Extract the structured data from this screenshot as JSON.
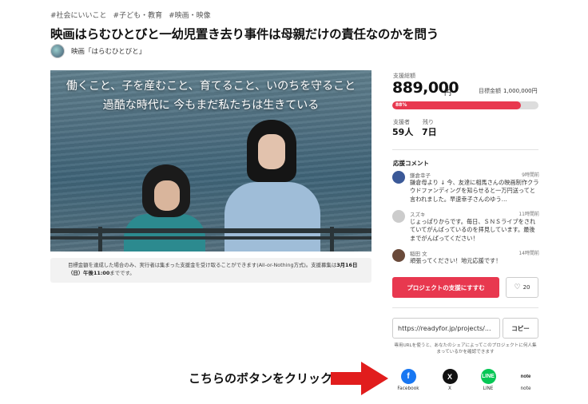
{
  "tags": [
    "#社会にいいこと",
    "#子ども・教育",
    "#映画・映像"
  ],
  "title": "映画はらむひとびと一幼児置き去り事件は母親だけの責任なのかを問う",
  "owner": {
    "name": "映画「はらむひとびと」"
  },
  "hero": {
    "line1": "働くこと、子を産むこと、育てること、いのちを守ること",
    "line2": "過酷な時代に 今もまだ私たちは生きている"
  },
  "notice": {
    "text": "目標金額を達成した場合のみ、実行者は集まった支援金を受け取ることができます(All-or-Nothing方式)。支援募集は",
    "deadline": "3月16日（日）午後11:00",
    "suffix": "までです。"
  },
  "stats": {
    "raised_label": "支援総額",
    "raised": "889,000",
    "unit": "円",
    "goal_label": "目標金額",
    "goal": "1,000,000円",
    "progress_label": "88%",
    "progress": 0.88,
    "supporters_label": "支援者",
    "supporters": "59人",
    "remaining_label": "残り",
    "remaining": "7日"
  },
  "comments": {
    "title": "応援コメント",
    "items": [
      {
        "name": "鎌倉幸子",
        "time": "9時間前",
        "text": "鎌倉母より ↓ 今、友達に相馬さんの映画制作クラウドファンディングを知らせると一万円送ってと言われました。早速幸子さんのゆう…"
      },
      {
        "name": "スズキ",
        "time": "11時間前",
        "text": "じょっぱりからです。毎日、ＳＮＳライブをされていてがんばっているのを拝見しています。最後までがんばってください！"
      },
      {
        "name": "稲田 文",
        "time": "14時間前",
        "text": "頑張ってください！地元応援です！"
      }
    ]
  },
  "actions": {
    "support": "プロジェクトの支援にすすむ",
    "favorite_count": "20"
  },
  "share": {
    "url": "https://readyfor.jp/projects/...",
    "copy": "コピー",
    "note": "専用URLを使うと、あなたのシェアによってこのプロジェクトに何人集まっているかを確認できます",
    "buttons": [
      {
        "label": "Facebook",
        "icon": "facebook-icon",
        "glyph": "f"
      },
      {
        "label": "X",
        "icon": "x-icon",
        "glyph": "X"
      },
      {
        "label": "LINE",
        "icon": "line-icon",
        "glyph": "LINE"
      },
      {
        "label": "note",
        "icon": "note-icon",
        "glyph": "note"
      }
    ]
  },
  "annotation": {
    "callout": "こちらのボタンをクリック",
    "arrow_color": "#e11d1d"
  },
  "colors": {
    "accent": "#e8384f",
    "facebook": "#1877f2",
    "line": "#06c755"
  }
}
